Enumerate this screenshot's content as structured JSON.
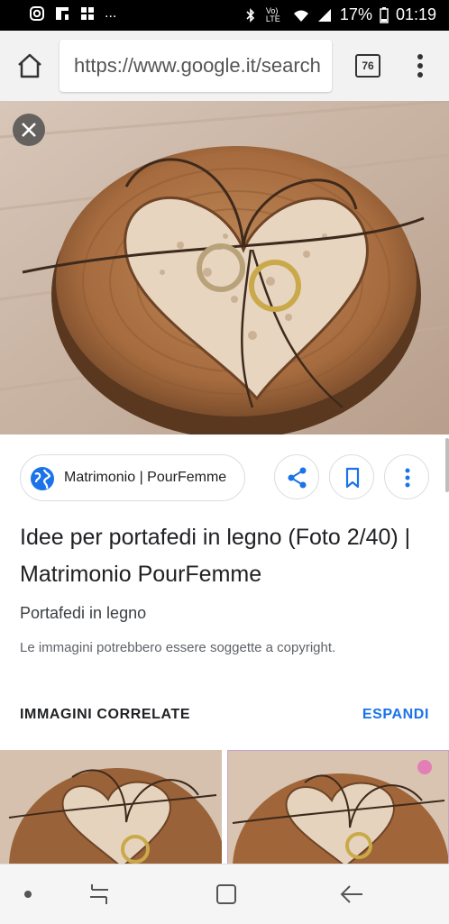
{
  "status_bar": {
    "time": "01:19",
    "battery": "17%",
    "network": "Vo) LTE",
    "left_more": "..."
  },
  "browser": {
    "url": "https://www.google.it/search",
    "tab_count": "76"
  },
  "result": {
    "source_label": "Matrimonio | PourFemme",
    "title": "Idee per portafedi in legno (Foto 2/40) | Matrimonio PourFemme",
    "subtitle": "Portafedi in legno",
    "copyright": "Le immagini potrebbero essere soggette a copyright."
  },
  "related": {
    "heading": "IMMAGINI CORRELATE",
    "expand": "ESPANDI"
  },
  "colors": {
    "accent": "#1a73e8",
    "text": "#202124"
  },
  "icons": [
    "instagram-icon",
    "flipboard-icon",
    "gallery-icon",
    "bluetooth-icon",
    "wifi-icon",
    "signal-icon",
    "battery-icon",
    "home-icon",
    "more-vert-icon",
    "close-icon",
    "globe-icon",
    "share-icon",
    "bookmark-icon",
    "nav-dot-icon",
    "recents-icon",
    "home-nav-icon",
    "back-icon"
  ]
}
